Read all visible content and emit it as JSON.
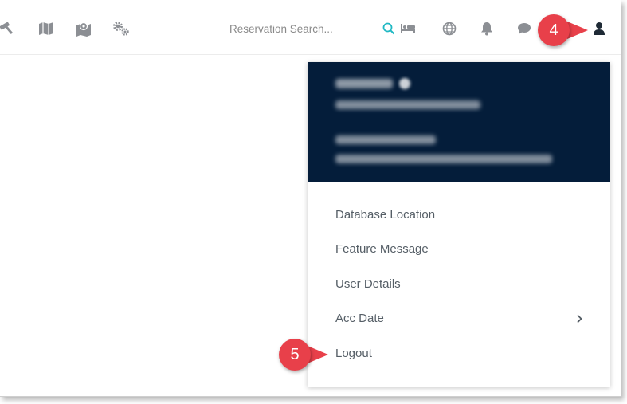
{
  "toolbar": {
    "icons": [
      "hammer-icon",
      "map-icon",
      "map-marker-icon",
      "gears-icon"
    ]
  },
  "search": {
    "placeholder": "Reservation Search...",
    "icons": [
      "search-icon",
      "bed-icon"
    ]
  },
  "header_icons": [
    "globe-icon",
    "bell-icon",
    "chat-icon",
    "user-icon"
  ],
  "callouts": {
    "step4": "4",
    "step5": "5"
  },
  "user_menu": {
    "items": [
      {
        "label": "Database Location"
      },
      {
        "label": "Feature Message"
      },
      {
        "label": "User Details"
      },
      {
        "label": "Acc Date",
        "has_submenu": true
      },
      {
        "label": "Logout"
      }
    ]
  },
  "colors": {
    "header_bg": "#041d3a",
    "accent": "#1fb8c3",
    "callout": "#e8404a",
    "icon_gray": "#8c8f94"
  }
}
